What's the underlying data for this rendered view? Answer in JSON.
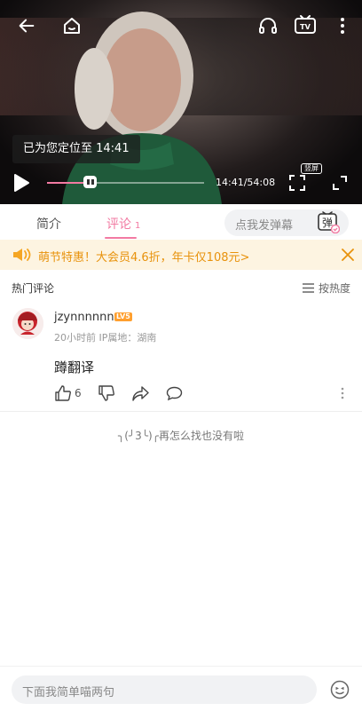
{
  "player": {
    "toast": "已为您定位至 14:41",
    "time_current": "14:41",
    "time_total": "54:08",
    "time_display": "14:41/54:08",
    "progress": 0.27,
    "portrait_label": "竖屏"
  },
  "tabs": [
    {
      "label": "简介"
    },
    {
      "label": "评论",
      "count": "1"
    }
  ],
  "danmaku": {
    "placeholder": "点我发弹幕",
    "button": "弹"
  },
  "promo": {
    "text": "萌节特惠！大会员4.6折，年卡仅108元>"
  },
  "comments_header": {
    "title": "热门评论",
    "sort_label": "按热度"
  },
  "comment": {
    "username": "jzynnnnnn",
    "level": "LV5",
    "meta": "20小时前 IP属地：湖南",
    "text": "蹲翻译",
    "likes": "6"
  },
  "end_text": "╮(╯3╰)╭再怎么找也没有啦",
  "bottom_input": {
    "placeholder": "下面我简单喵两句"
  },
  "colors": {
    "accent": "#f27aa2",
    "promo_text": "#e8920c",
    "level_badge": "#ff9f2e"
  }
}
